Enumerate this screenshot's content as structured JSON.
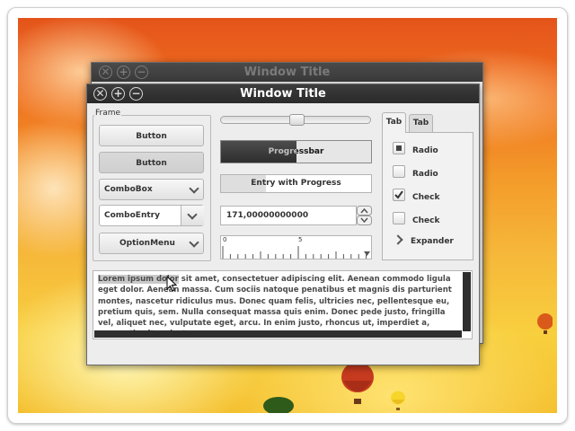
{
  "back_window": {
    "title": "Window Title"
  },
  "front_window": {
    "title": "Window Title"
  },
  "titlebar_buttons": {
    "close": "✕",
    "maximize": "+",
    "minimize": "−"
  },
  "frame": {
    "label": "Frame",
    "button1": "Button",
    "button2": "Button",
    "combobox": "ComboBox",
    "comboentry": "ComboEntry",
    "optionmenu": "OptionMenu"
  },
  "middle": {
    "slider_value_fraction": 0.5,
    "progressbar_label": "Progressbar",
    "progressbar_fraction": 0.5,
    "entry_progress_label": "Entry with Progress",
    "entry_progress_fraction": 0.3,
    "spin_value": "171,00000000000",
    "ruler_ticks": [
      "0",
      "5"
    ]
  },
  "notebook": {
    "tabs": [
      "Tab",
      "Tab"
    ],
    "radio1": "Radio",
    "radio2": "Radio",
    "check1": "Check",
    "check2": "Check",
    "expander": "Expander"
  },
  "textview": {
    "selected": "Lorem ipsum dolor",
    "text": " sit amet, consectetuer adipiscing elit. Aenean commodo ligula eget dolor. Aenean massa. Cum sociis natoque penatibus et magnis dis parturient montes, nascetur ridiculus mus. Donec quam felis, ultricies nec, pellentesque eu, pretium quis, sem. Nulla consequat massa quis enim. Donec pede justo, fringilla vel, aliquet nec, vulputate eget, arcu. In enim justo, rhoncus ut, imperdiet a, venenatis vitae, justo."
  },
  "colors": {
    "titlebar": "#2a2a2a",
    "window_bg": "#ededed",
    "progress_fill": "#3a3a3a"
  }
}
